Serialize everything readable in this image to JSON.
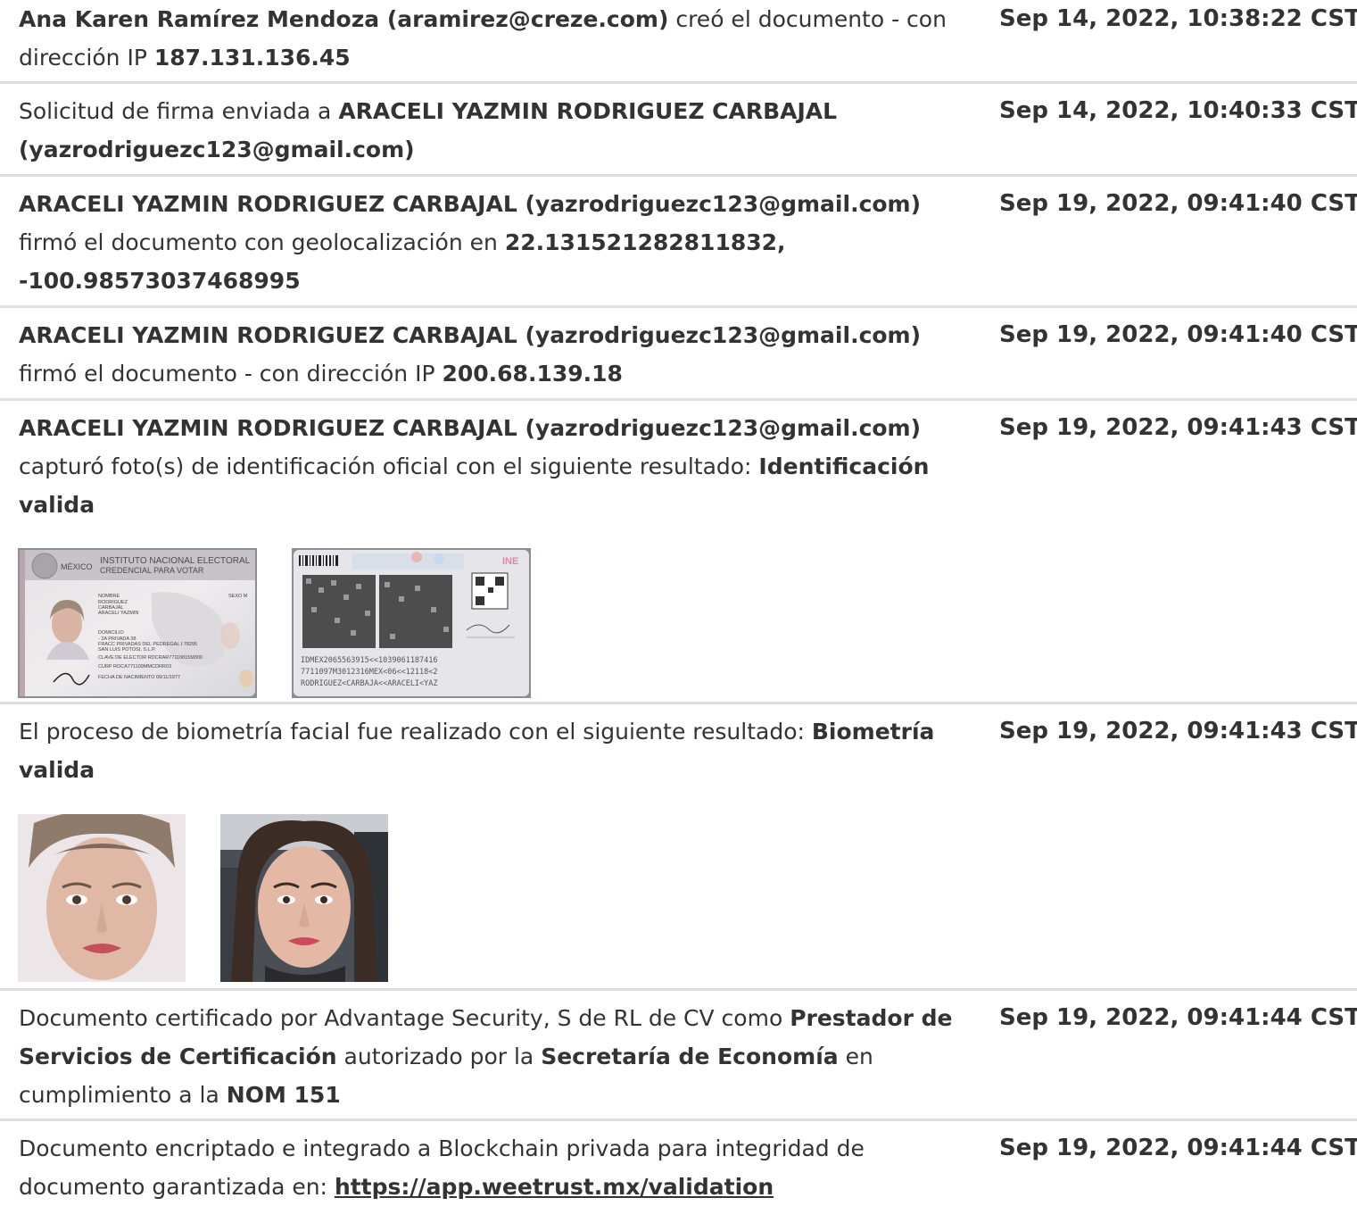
{
  "entries": [
    {
      "actor": "Ana Karen Ramírez Mendoza (aramirez@creze.com)",
      "action": " creó el documento - con dirección IP ",
      "ip": "187.131.136.45",
      "time": "Sep 14, 2022, 10:38:22 CST"
    },
    {
      "prefix": "Solicitud de firma enviada a ",
      "recipient": "ARACELI YAZMIN RODRIGUEZ CARBAJAL (yazrodriguezc123@gmail.com)",
      "time": "Sep 14, 2022, 10:40:33 CST"
    },
    {
      "actor": "ARACELI YAZMIN RODRIGUEZ CARBAJAL (yazrodriguezc123@gmail.com)",
      "action": " firmó el documento con geolocalización en ",
      "geo": "22.131521282811832, -100.98573037468995",
      "time": "Sep 19, 2022, 09:41:40 CST"
    },
    {
      "actor": "ARACELI YAZMIN RODRIGUEZ CARBAJAL (yazrodriguezc123@gmail.com)",
      "action": " firmó el documento - con dirección IP ",
      "ip": "200.68.139.18",
      "time": "Sep 19, 2022, 09:41:40 CST"
    },
    {
      "actor": "ARACELI YAZMIN RODRIGUEZ CARBAJAL (yazrodriguezc123@gmail.com)",
      "action": " capturó foto(s) de identificación oficial con el siguiente resultado: ",
      "result": "Identificación valida",
      "time": "Sep 19, 2022, 09:41:43 CST",
      "id_front": {
        "country": "MÉXICO",
        "institute": "INSTITUTO NACIONAL ELECTORAL",
        "credential": "CREDENCIAL PARA VOTAR",
        "name_label": "NOMBRE",
        "name_lines": [
          "RODRIGUEZ",
          "CARBAJAL",
          "ARACELI YAZMIN"
        ],
        "sex": "SEXO M",
        "address_label": "DOMICILIO",
        "address_lines": [
          "- 2A PRIVADA 38",
          "FRACC PRIVADAS DEL PEDREGAL I 78295",
          "SAN LUIS POTOSI, S.L.P."
        ],
        "elector_key": "CLAVE DE ELECTOR  RDCRAR77110815M300",
        "curp": "CURP  ROCA771109MMCDRR03",
        "birth": "FECHA DE NACIMIENTO 09/11/1977"
      },
      "id_back": {
        "brand": "INE",
        "mrz": [
          "IDMEX2065563915<<1039061187416",
          "7711097M3012316MEX<06<<12118<2",
          "RODRIGUEZ<CARBAJA<<ARACELI<YAZ"
        ]
      }
    },
    {
      "text": "El proceso de biometría facial fue realizado con el siguiente resultado: ",
      "result": "Biometría valida",
      "time": "Sep 19, 2022, 09:41:43 CST"
    },
    {
      "t1": "Documento certificado por Advantage Security, S de RL de CV como ",
      "b1": "Prestador de Servicios de Certificación",
      "t2": " autorizado por la ",
      "b2": "Secretaría de Economía",
      "t3": " en cumplimiento a la ",
      "b3": "NOM 151",
      "time": "Sep 19, 2022, 09:41:44 CST"
    },
    {
      "text": "Documento encriptado e integrado a Blockchain privada para integridad de documento garantizada en: ",
      "link": "https://app.weetrust.mx/validation",
      "time": "Sep 19, 2022, 09:41:44 CST"
    }
  ]
}
